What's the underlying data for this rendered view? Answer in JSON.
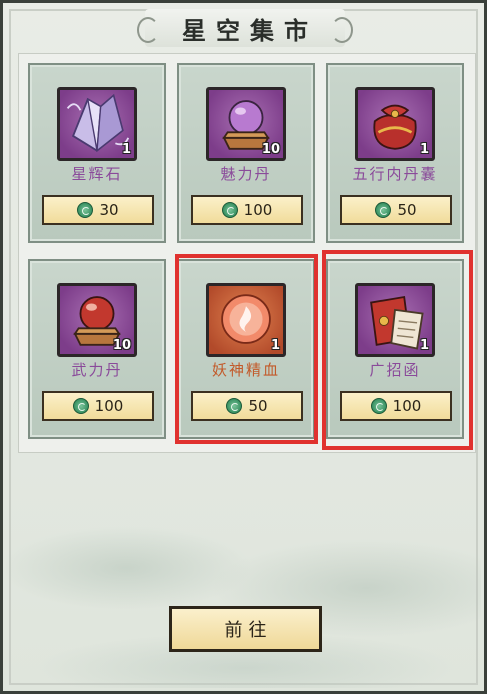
{
  "title": "星空集市",
  "items": [
    {
      "name": "星辉石",
      "qty": "1",
      "price": "30",
      "icon": "crystal-icon",
      "theme": "purple"
    },
    {
      "name": "魅力丹",
      "qty": "10",
      "price": "100",
      "icon": "pill-orb-icon",
      "theme": "purple"
    },
    {
      "name": "五行内丹囊",
      "qty": "1",
      "price": "50",
      "icon": "pouch-icon",
      "theme": "purple"
    },
    {
      "name": "武力丹",
      "qty": "10",
      "price": "100",
      "icon": "red-pill-orb-icon",
      "theme": "purple"
    },
    {
      "name": "妖神精血",
      "qty": "1",
      "price": "50",
      "icon": "blood-orb-icon",
      "theme": "orange"
    },
    {
      "name": "广招函",
      "qty": "1",
      "price": "100",
      "icon": "letter-icon",
      "theme": "purple"
    }
  ],
  "go_button_label": "前往",
  "colors": {
    "highlight": "#e0322f",
    "item_name_purple": "#8a4a9a",
    "item_name_orange": "#c25a2a"
  }
}
